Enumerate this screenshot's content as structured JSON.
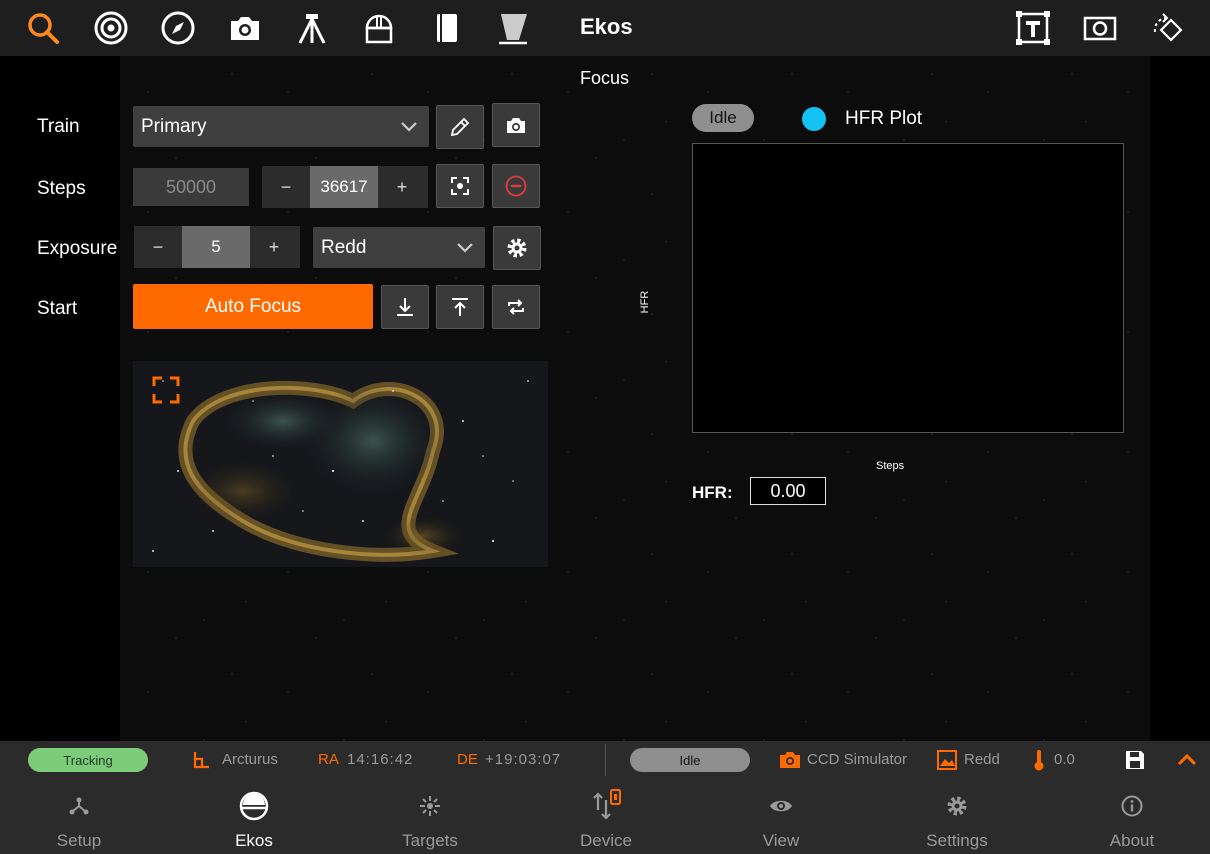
{
  "app": {
    "title": "Ekos",
    "section": "Focus"
  },
  "toolbar": {
    "left_icons": [
      "search-icon",
      "target-icon",
      "compass-icon",
      "camera-icon",
      "tripod-icon",
      "observatory-icon",
      "book-icon",
      "flat-panel-icon"
    ],
    "right_icons": [
      "text-frame-icon",
      "snapshot-icon",
      "rotate-icon"
    ]
  },
  "form": {
    "train": {
      "label": "Train",
      "value": "Primary"
    },
    "steps": {
      "label": "Steps",
      "max": "50000",
      "value": "36617",
      "minus": "−",
      "plus": "+"
    },
    "exposure": {
      "label": "Exposure",
      "value": "5",
      "minus": "−",
      "plus": "+",
      "filter": "Redd"
    },
    "start": {
      "label": "Start",
      "button": "Auto Focus"
    }
  },
  "plot": {
    "status": "Idle",
    "legend": "HFR Plot",
    "legend_color": "#13c2f2",
    "ylabel": "HFR",
    "xlabel": "Steps",
    "hfr_label": "HFR:",
    "hfr_value": "0.00"
  },
  "status_bar": {
    "tracking": "Tracking",
    "target": "Arcturus",
    "ra_label": "RA",
    "ra_value": "14:16:42",
    "de_label": "DE",
    "de_value": "+19:03:07",
    "camera_status": "Idle",
    "camera": "CCD Simulator",
    "filter": "Redd",
    "temperature": "0.0"
  },
  "nav": {
    "items": [
      {
        "label": "Setup",
        "icon": "setup-icon"
      },
      {
        "label": "Ekos",
        "icon": "ekos-icon"
      },
      {
        "label": "Targets",
        "icon": "targets-icon"
      },
      {
        "label": "Device",
        "icon": "device-icon"
      },
      {
        "label": "View",
        "icon": "eye-icon"
      },
      {
        "label": "Settings",
        "icon": "gear-icon"
      },
      {
        "label": "About",
        "icon": "info-icon"
      }
    ],
    "active": "Ekos"
  },
  "colors": {
    "accent": "#ff6a00",
    "tracking": "#7ccc7a",
    "idle": "#8f8f8f",
    "stop": "#e23b3b"
  }
}
